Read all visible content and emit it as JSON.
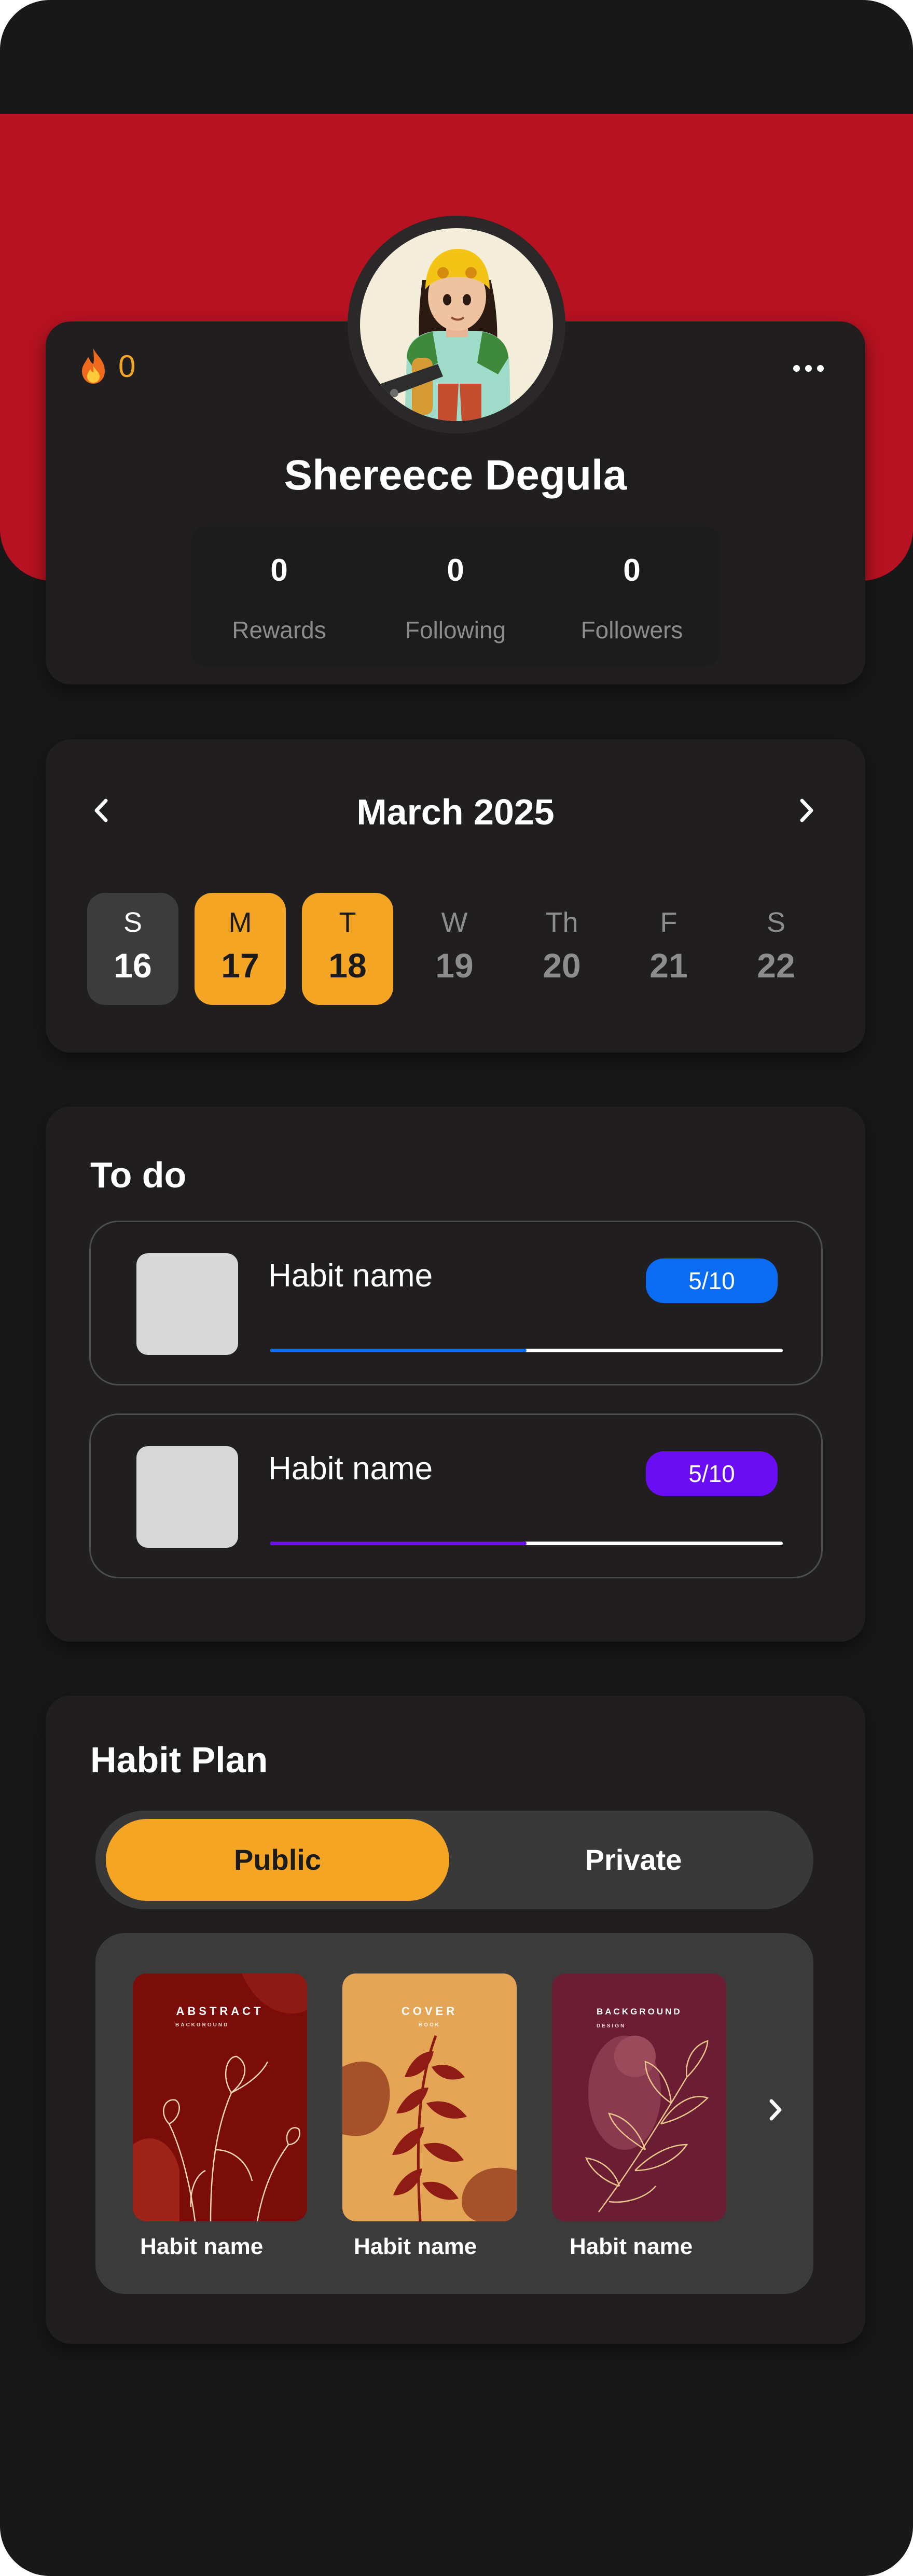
{
  "profile": {
    "streak_count": "0",
    "name": "Shereece Degula",
    "stats": [
      {
        "value": "0",
        "label": "Rewards"
      },
      {
        "value": "0",
        "label": "Following"
      },
      {
        "value": "0",
        "label": "Followers"
      }
    ]
  },
  "calendar": {
    "month": "March 2025",
    "days": [
      {
        "name": "S",
        "date": "16",
        "state": "today"
      },
      {
        "name": "M",
        "date": "17",
        "state": "selected"
      },
      {
        "name": "T",
        "date": "18",
        "state": "selected"
      },
      {
        "name": "W",
        "date": "19",
        "state": "normal"
      },
      {
        "name": "Th",
        "date": "20",
        "state": "normal"
      },
      {
        "name": "F",
        "date": "21",
        "state": "normal"
      },
      {
        "name": "S",
        "date": "22",
        "state": "normal"
      }
    ]
  },
  "todo": {
    "title": "To do",
    "habits": [
      {
        "name": "Habit name",
        "progress_text": "5/10",
        "progress": 0.5,
        "color": "#0a6cf3"
      },
      {
        "name": "Habit name",
        "progress_text": "5/10",
        "progress": 0.5,
        "color": "#6a0df5"
      }
    ]
  },
  "plan": {
    "title": "Habit Plan",
    "toggle": {
      "public": "Public",
      "private": "Private",
      "active": "Public"
    },
    "cards": [
      {
        "label": "Habit name",
        "cover_title": "ABSTRACT",
        "cover_subtitle": "BACKGROUND"
      },
      {
        "label": "Habit name",
        "cover_title": "COVER",
        "cover_subtitle": "BOOK"
      },
      {
        "label": "Habit name",
        "cover_title": "BACKGROUND",
        "cover_subtitle": "DESIGN"
      }
    ]
  },
  "colors": {
    "accent": "#f5a524",
    "hero": "#b71221",
    "card": "#201e1f",
    "background": "#181818"
  },
  "icons": {
    "streak": "fire-icon",
    "more": "more-dots-icon",
    "prev": "chevron-left-icon",
    "next": "chevron-right-icon"
  }
}
